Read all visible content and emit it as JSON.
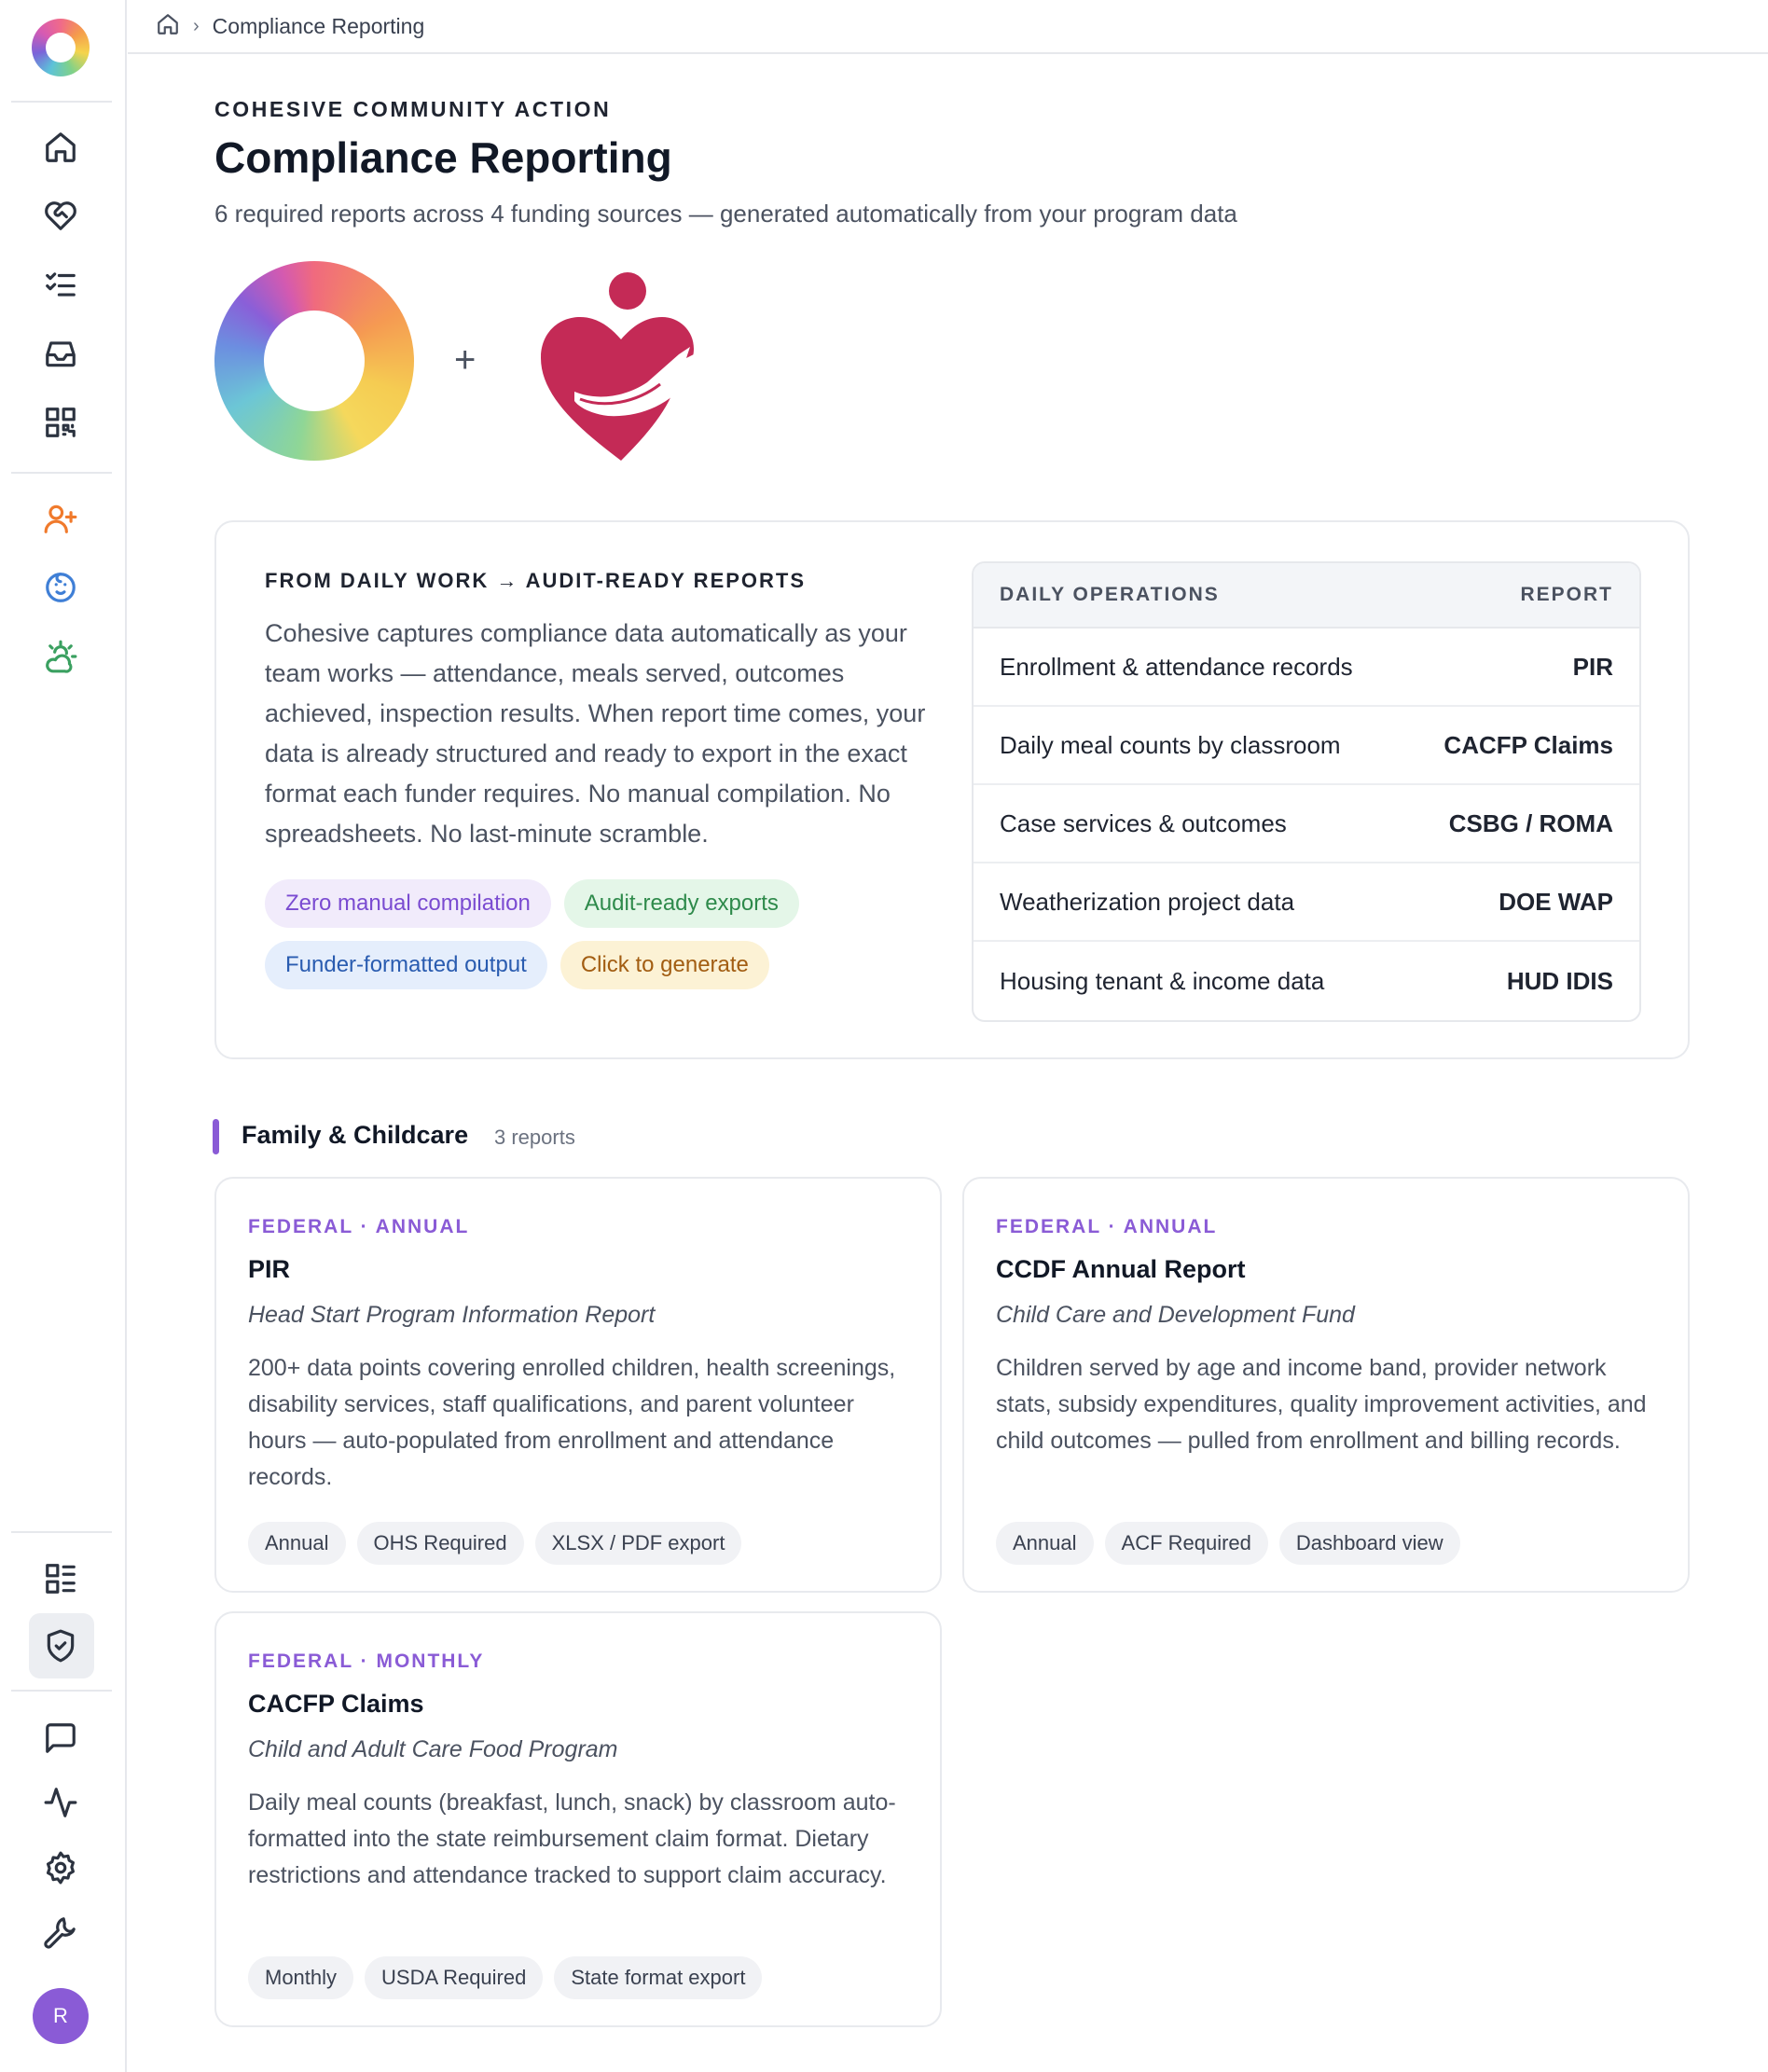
{
  "sidebar": {
    "nav_top": [
      "home-icon",
      "heart-handshake-icon",
      "checklist-icon",
      "inbox-icon",
      "qr-code-icon"
    ],
    "nav_programs": [
      "user-plus-icon",
      "baby-face-icon",
      "sun-cloud-icon"
    ],
    "nav_bottom": [
      "dashboard-grid-icon",
      "shield-check-icon",
      "chat-icon",
      "activity-icon",
      "settings-icon",
      "wrench-icon"
    ],
    "avatar_initial": "R"
  },
  "breadcrumb": {
    "current": "Compliance Reporting"
  },
  "header": {
    "org": "COHESIVE COMMUNITY ACTION",
    "title": "Compliance Reporting",
    "subtitle": "6 required reports across 4 funding sources — generated automatically from your program data",
    "plus": "+"
  },
  "info": {
    "heading": "FROM DAILY WORK → AUDIT-READY REPORTS",
    "body": "Cohesive captures compliance data automatically as your team works — attendance, meals served, outcomes achieved, inspection results. When report time comes, your data is already structured and ready to export in the exact format each funder requires. No manual compilation. No spreadsheets. No last-minute scramble.",
    "pills": [
      "Zero manual compilation",
      "Audit-ready exports",
      "Funder-formatted output",
      "Click to generate"
    ],
    "table": {
      "col_left": "DAILY OPERATIONS",
      "col_right": "REPORT",
      "rows": [
        {
          "op": "Enrollment & attendance records",
          "report": "PIR"
        },
        {
          "op": "Daily meal counts by classroom",
          "report": "CACFP Claims"
        },
        {
          "op": "Case services & outcomes",
          "report": "CSBG / ROMA"
        },
        {
          "op": "Weatherization project data",
          "report": "DOE WAP"
        },
        {
          "op": "Housing tenant & income data",
          "report": "HUD IDIS"
        }
      ]
    }
  },
  "section": {
    "title": "Family & Childcare",
    "count": "3 reports",
    "reports": [
      {
        "meta": "FEDERAL · ANNUAL",
        "name": "PIR",
        "full": "Head Start Program Information Report",
        "desc": "200+ data points covering enrolled children, health screenings, disability services, staff qualifications, and parent volunteer hours — auto-populated from enrollment and attendance records.",
        "tags": [
          "Annual",
          "OHS Required",
          "XLSX / PDF export"
        ]
      },
      {
        "meta": "FEDERAL · ANNUAL",
        "name": "CCDF Annual Report",
        "full": "Child Care and Development Fund",
        "desc": "Children served by age and income band, provider network stats, subsidy expenditures, quality improvement activities, and child outcomes — pulled from enrollment and billing records.",
        "tags": [
          "Annual",
          "ACF Required",
          "Dashboard view"
        ]
      },
      {
        "meta": "FEDERAL · MONTHLY",
        "name": "CACFP Claims",
        "full": "Child and Adult Care Food Program",
        "desc": "Daily meal counts (breakfast, lunch, snack) by classroom auto-formatted into the state reimbursement claim format. Dietary restrictions and attendance tracked to support claim accuracy.",
        "tags": [
          "Monthly",
          "USDA Required",
          "State format export"
        ]
      }
    ]
  }
}
